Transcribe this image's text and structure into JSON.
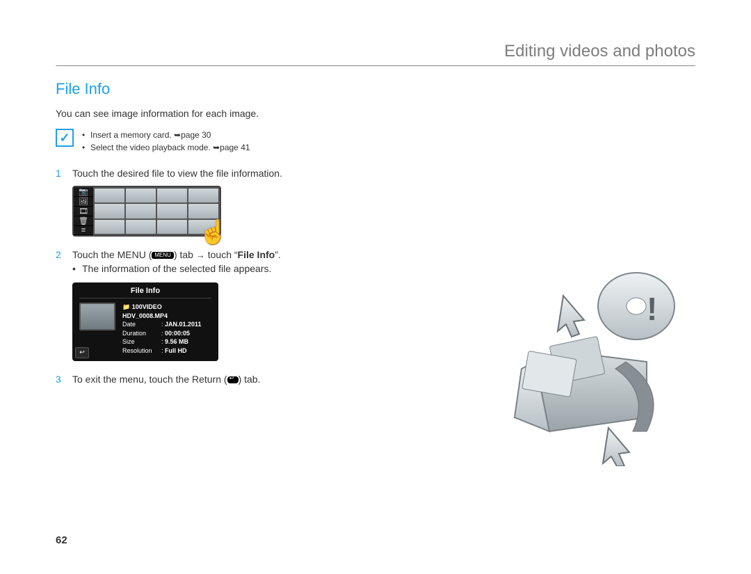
{
  "header": {
    "title": "Editing videos and photos"
  },
  "section": {
    "title": "File Info",
    "intro": "You can see image information for each image."
  },
  "note": {
    "icon_label": "✓",
    "items": [
      "Insert a memory card. ➥page 30",
      "Select the video playback mode. ➥page 41"
    ]
  },
  "steps": {
    "s1": {
      "num": "1",
      "text": "Touch the desired file to view the file information."
    },
    "s2": {
      "num": "2",
      "pre": "Touch the MENU (",
      "menu_label": "MENU",
      "mid": ") tab ",
      "arrow": "→",
      "post_pre": " touch “",
      "bold": "File Info",
      "post_suf": "”.",
      "sub": "The information of the selected file appears."
    },
    "s3": {
      "num": "3",
      "pre": "To exit the menu, touch the Return (",
      "post": ") tab."
    }
  },
  "thumb_sidebar_icons": [
    "📷",
    "🖼",
    "🎞",
    "🗑",
    "≡"
  ],
  "fileinfo_panel": {
    "title": "File Info",
    "folder_icon": "📁",
    "folder": "100VIDEO",
    "filename": "HDV_0008.MP4",
    "rows": [
      {
        "k": "Date",
        "v": "JAN.01.2011"
      },
      {
        "k": "Duration",
        "v": "00:00:05"
      },
      {
        "k": "Size",
        "v": "9.56 MB"
      },
      {
        "k": "Resolution",
        "v": "Full HD"
      }
    ],
    "back_icon": "↩"
  },
  "page_number": "62"
}
